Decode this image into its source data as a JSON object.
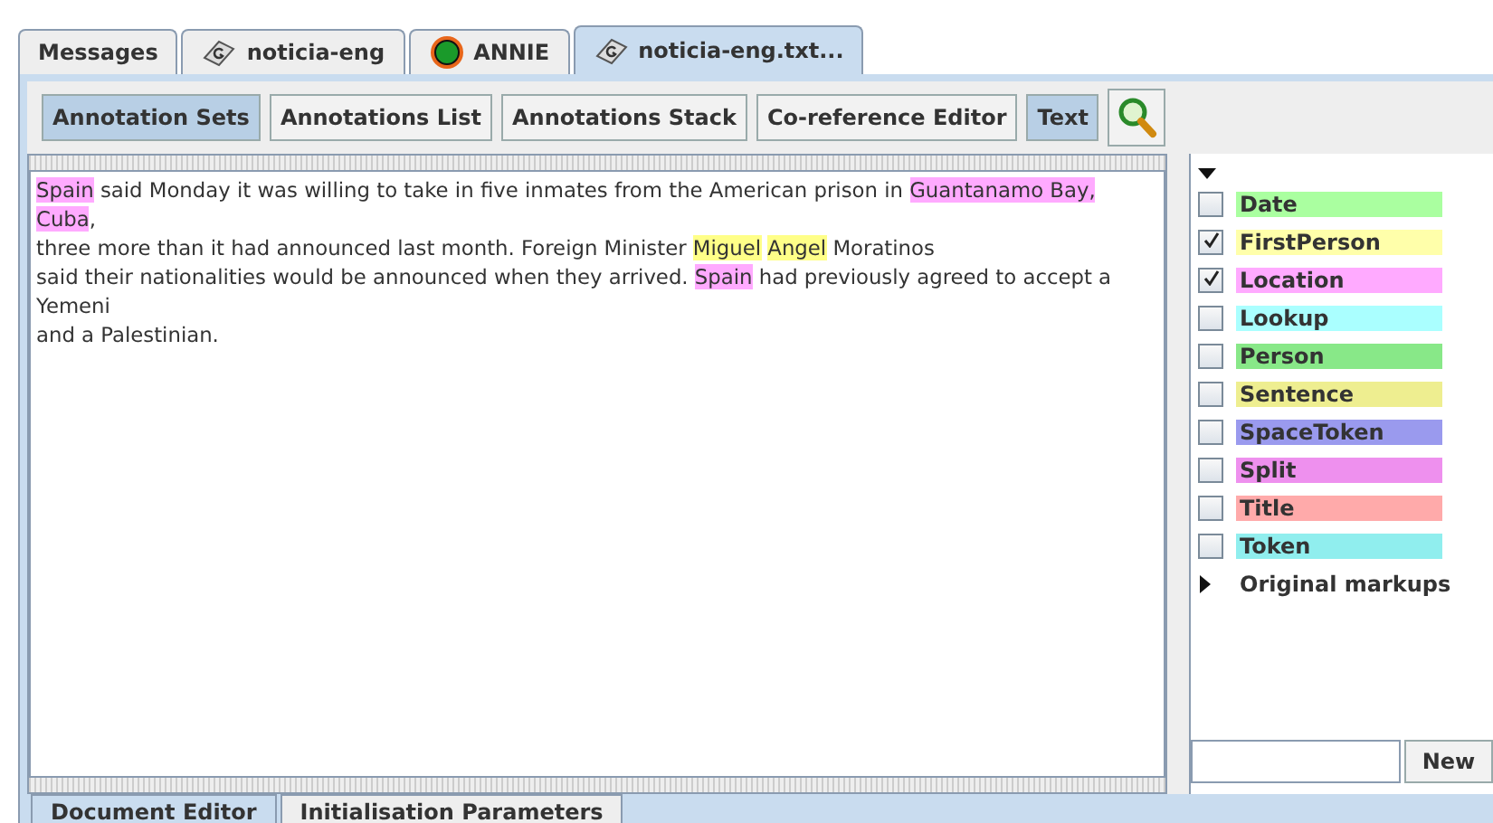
{
  "tabs": [
    {
      "label": "Messages",
      "kind": "plain",
      "selected": false
    },
    {
      "label": "noticia-eng",
      "kind": "document",
      "selected": false
    },
    {
      "label": "ANNIE",
      "kind": "app",
      "selected": false
    },
    {
      "label": "noticia-eng.txt...",
      "kind": "document",
      "selected": true
    }
  ],
  "toolbar": [
    {
      "label": "Annotation Sets",
      "selected": true
    },
    {
      "label": "Annotations List",
      "selected": false
    },
    {
      "label": "Annotations Stack",
      "selected": false
    },
    {
      "label": "Co-reference Editor",
      "selected": false
    },
    {
      "label": "Text",
      "selected": true
    }
  ],
  "text_lines": [
    [
      {
        "text": "Spain",
        "color": "#ffaaff"
      },
      {
        "text": " said Monday it was willing to take in five inmates from the American prison in "
      },
      {
        "text": "Guantanamo Bay,",
        "color": "#ffaaff"
      }
    ],
    [
      {
        "text": "Cuba",
        "color": "#ffaaff"
      },
      {
        "text": ","
      }
    ],
    [
      {
        "text": "three more than it had announced last month. Foreign Minister "
      },
      {
        "text": "Miguel",
        "color": "#ffff88"
      },
      {
        "text": "Angel",
        "color": "#ffff88",
        "gap_before": true
      },
      {
        "text": " Moratinos"
      }
    ],
    [
      {
        "text": "said their nationalities would be announced when they arrived. "
      },
      {
        "text": "Spain",
        "color": "#ffaaff"
      },
      {
        "text": " had previously agreed to accept a"
      }
    ],
    [
      {
        "text": "Yemeni"
      }
    ],
    [
      {
        "text": "and a Palestinian."
      }
    ]
  ],
  "annotation_types": [
    {
      "label": "Date",
      "color": "#aaffa0",
      "checked": false
    },
    {
      "label": "FirstPerson",
      "color": "#ffffaa",
      "checked": true
    },
    {
      "label": "Location",
      "color": "#ffaaff",
      "checked": true
    },
    {
      "label": "Lookup",
      "color": "#aaffff",
      "checked": false
    },
    {
      "label": "Person",
      "color": "#88e888",
      "checked": false
    },
    {
      "label": "Sentence",
      "color": "#eeee90",
      "checked": false
    },
    {
      "label": "SpaceToken",
      "color": "#9a9aee",
      "checked": false
    },
    {
      "label": "Split",
      "color": "#ee90ee",
      "checked": false
    },
    {
      "label": "Title",
      "color": "#ffaaaa",
      "checked": false
    },
    {
      "label": "Token",
      "color": "#90eeee",
      "checked": false
    }
  ],
  "other_sets": [
    {
      "label": "Original markups",
      "expanded": false
    }
  ],
  "new_set": {
    "button": "New"
  },
  "bottom_tabs": [
    {
      "label": "Document Editor",
      "selected": true
    },
    {
      "label": "Initialisation Parameters",
      "selected": false
    }
  ]
}
